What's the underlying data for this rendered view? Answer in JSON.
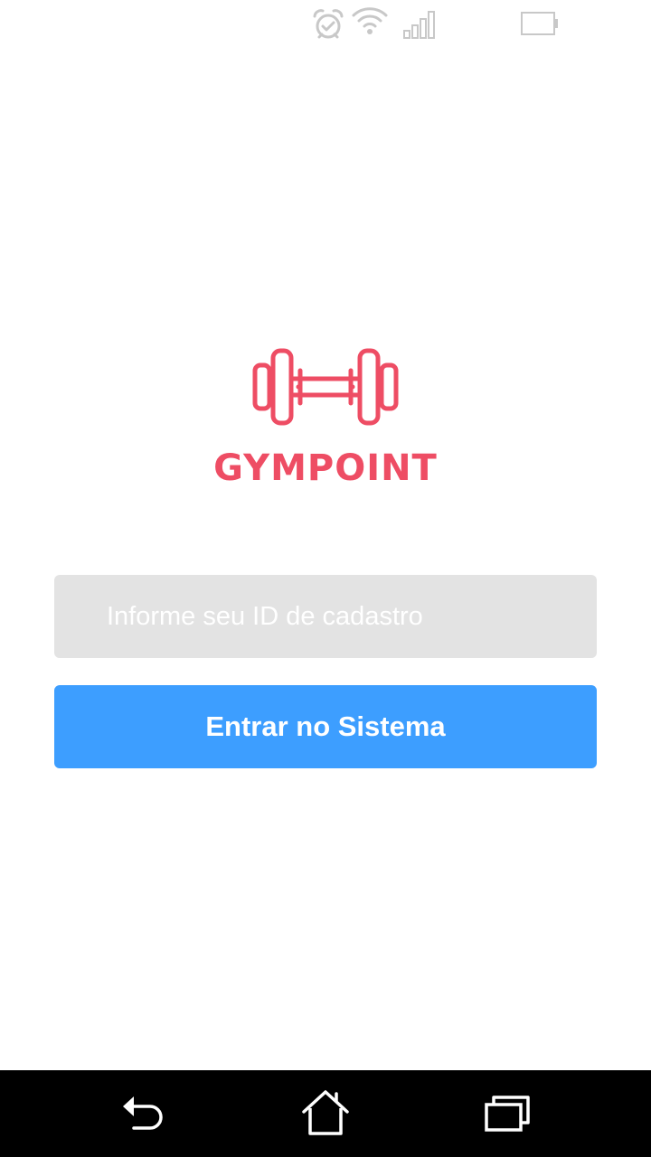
{
  "status_bar": {
    "icons": [
      "alarm-icon",
      "wifi-icon",
      "signal-icon",
      "battery-icon"
    ],
    "icon_color": "#c8c8c8"
  },
  "brand": {
    "name": "GYMPOINT",
    "logo_icon": "dumbbell-icon",
    "color": "#ee4d64"
  },
  "login": {
    "id_input_placeholder": "Informe seu ID de cadastro",
    "id_input_value": "",
    "submit_label": "Entrar no Sistema",
    "input_background": "#e3e3e3",
    "button_color": "#3d9eff"
  },
  "nav_bar": {
    "buttons": [
      "back-icon",
      "home-icon",
      "recents-icon"
    ],
    "background": "#000000"
  }
}
